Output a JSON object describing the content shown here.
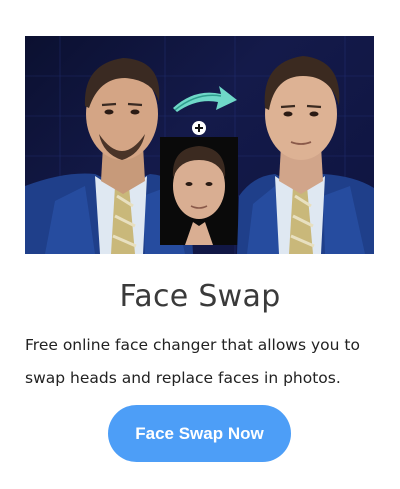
{
  "feature": {
    "title": "Face Swap",
    "description": "Free online face changer that allows you to swap heads and replace faces in photos.",
    "button_label": "Face Swap Now",
    "hero_image": {
      "icons": [
        "source-portrait",
        "arrow-icon",
        "plus-icon",
        "face-thumbnail",
        "result-portrait"
      ]
    }
  },
  "colors": {
    "button_bg": "#4d9ef7",
    "title_text": "#3a3a3a",
    "hero_bg": "#121846",
    "arrow": "#6fd8c8"
  }
}
